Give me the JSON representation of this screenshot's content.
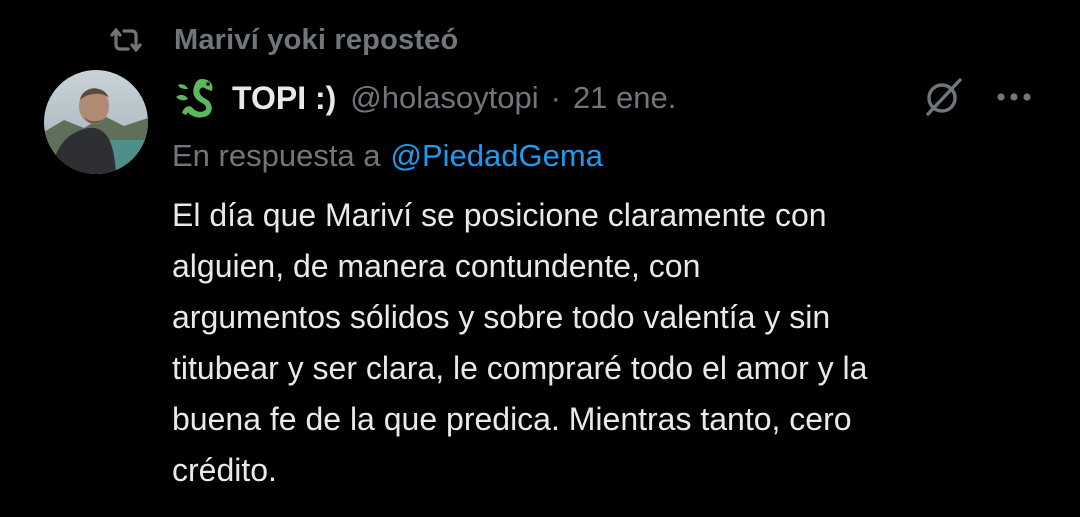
{
  "repost": {
    "icon": "repost-icon",
    "label": "Mariví yoki reposteó"
  },
  "author": {
    "avatar_icon": "avatar-photo",
    "emoji_icon": "dragon-emoji-icon",
    "display_name": "TOPI :)",
    "handle": "@holasoytopi",
    "separator": "·",
    "date": "21 ene."
  },
  "actions": {
    "grok_icon": "grok-icon",
    "more_icon": "more-icon"
  },
  "reply": {
    "prefix": "En respuesta a",
    "mention": "@PiedadGema"
  },
  "tweet": {
    "lines": [
      "El día que Mariví se posicione claramente con",
      "alguien, de manera contundente, con",
      "argumentos sólidos y sobre todo valentía y sin",
      "titubear y ser clara, le compraré todo el amor y la",
      "buena fe de la que predica. Mientras tanto, cero",
      "crédito."
    ]
  },
  "colors": {
    "background": "#000000",
    "text_primary": "#e7e9ea",
    "text_secondary": "#71767b",
    "link": "#1d9bf0",
    "emoji_green": "#5cb85c"
  }
}
